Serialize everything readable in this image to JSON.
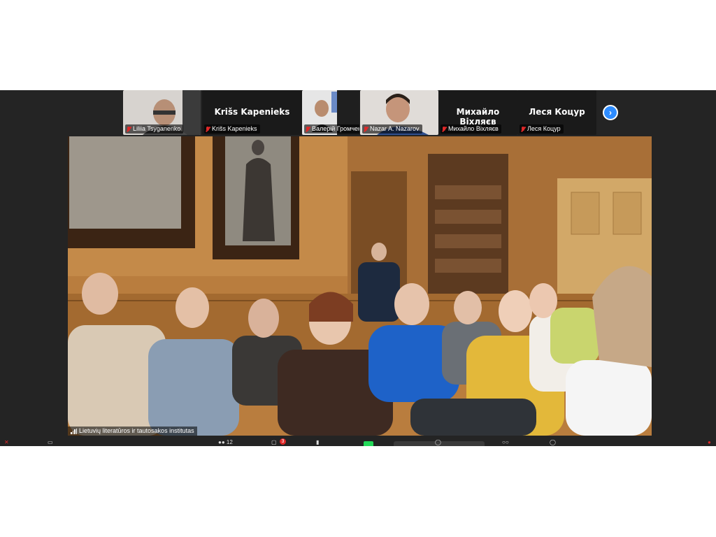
{
  "thumbnails": [
    {
      "id": "lt",
      "label": "Liliia Tsyganenko",
      "big_name": "",
      "has_video": true
    },
    {
      "id": "kk",
      "label": "Krišs Kapenieks",
      "big_name": "Krišs Kapenieks",
      "has_video": false
    },
    {
      "id": "vg",
      "label": "Валерій Громченко",
      "big_name": "",
      "has_video": true
    },
    {
      "id": "nn",
      "label": "Nazar A. Nazarov",
      "big_name": "",
      "has_video": true
    },
    {
      "id": "mv",
      "label": "Михайло Віхляєв",
      "big_name": "Михайло Віхляєв",
      "has_video": false
    },
    {
      "id": "lk",
      "label": "Леся Коцур",
      "big_name": "Леся Коцур",
      "has_video": false
    }
  ],
  "next_page_icon": "chevron-right-icon",
  "active_speaker": {
    "label": "Lietuvių literatūros ir tautosakos institutas"
  },
  "toolbar": {
    "participants_count": "12",
    "chat_badge": "3"
  },
  "colors": {
    "accent": "#2d8cff",
    "muted_mic": "#e02828",
    "background": "#242424",
    "share_green": "#23d959"
  }
}
